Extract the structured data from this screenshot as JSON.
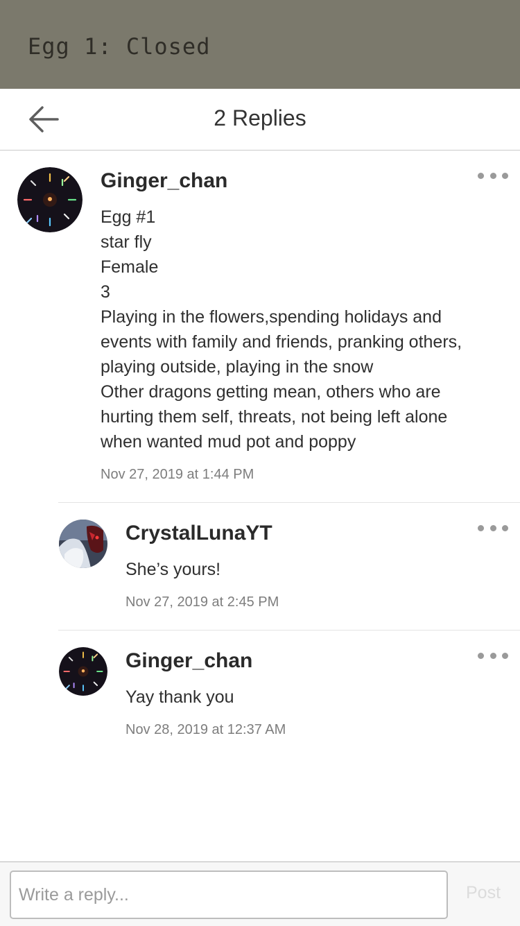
{
  "banner": {
    "title": "Egg 1: Closed",
    "background": "#7b796c"
  },
  "nav": {
    "back_icon": "arrow-left-icon",
    "title": "2 Replies"
  },
  "comments": [
    {
      "author": "Ginger_chan",
      "lines": [
        "Egg #1",
        "star fly",
        "Female",
        "3",
        "Playing in the flowers,spending holidays and",
        "events with family and friends, pranking others,",
        "playing outside, playing in the snow",
        "Other dragons getting mean, others who are",
        "hurting them self, threats, not being left alone",
        "when wanted mud pot and poppy"
      ],
      "timestamp": "Nov 27, 2019 at 1:44 PM",
      "avatar": "starburst-avatar"
    },
    {
      "author": "CrystalLunaYT",
      "lines": [
        "She’s yours!"
      ],
      "timestamp": "Nov 27, 2019 at 2:45 PM",
      "avatar": "wolf-avatar"
    },
    {
      "author": "Ginger_chan",
      "lines": [
        "Yay thank you"
      ],
      "timestamp": "Nov 28, 2019 at 12:37 AM",
      "avatar": "starburst-avatar"
    }
  ],
  "more_icon": "more-dots-icon",
  "reply": {
    "placeholder": "Write a reply...",
    "value": "",
    "post_label": "Post"
  }
}
